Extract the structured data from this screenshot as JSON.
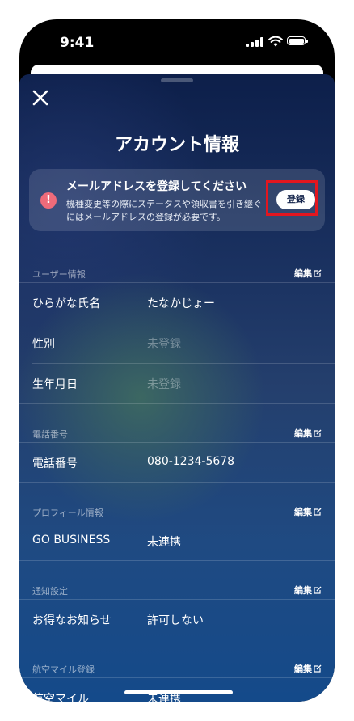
{
  "status_bar": {
    "time": "9:41"
  },
  "header": {
    "title": "アカウント情報",
    "close_icon": "close-icon"
  },
  "banner": {
    "title": "メールアドレスを登録してください",
    "description": "機種変更等の際にステータスや領収書を引き継ぐにはメールアドレスの登録が必要です。",
    "button_label": "登録",
    "alert_symbol": "!",
    "alert_color": "#ee6b7a",
    "highlight_color": "#e3161f"
  },
  "edit_label": "編集",
  "sections": {
    "user": {
      "header": "ユーザー情報",
      "rows": [
        {
          "label": "ひらがな氏名",
          "value": "たなかじょー"
        },
        {
          "label": "性別",
          "value": "未登録"
        },
        {
          "label": "生年月日",
          "value": "未登録"
        }
      ]
    },
    "phone": {
      "header": "電話番号",
      "rows": [
        {
          "label": "電話番号",
          "value": "080-1234-5678"
        }
      ]
    },
    "profile": {
      "header": "プロフィール情報",
      "rows": [
        {
          "label": "GO BUSINESS",
          "value": "未連携"
        }
      ]
    },
    "notify": {
      "header": "通知設定",
      "rows": [
        {
          "label": "お得なお知らせ",
          "value": "許可しない"
        }
      ]
    },
    "mileage": {
      "header": "航空マイル登録",
      "rows": [
        {
          "label": "航空マイル",
          "value": "未連携"
        }
      ]
    }
  }
}
